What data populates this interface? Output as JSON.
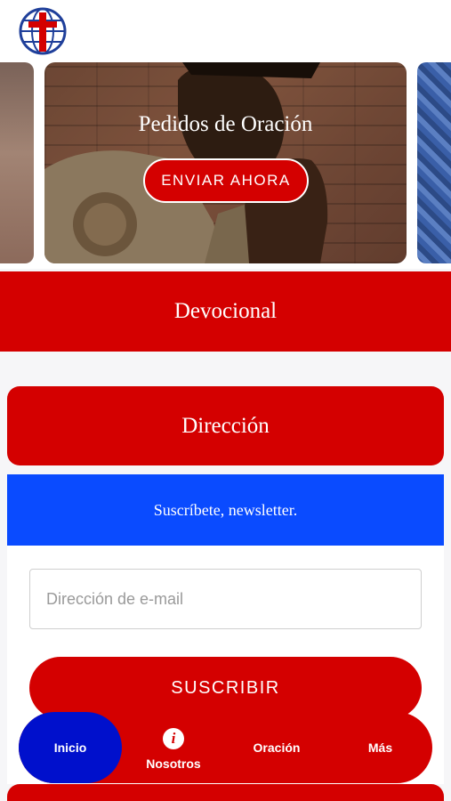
{
  "header": {
    "logo_icon": "globe-cross-logo"
  },
  "carousel": {
    "card": {
      "title": "Pedidos de Oración",
      "button_label": "ENVIAR AHORA"
    }
  },
  "sections": {
    "devocional_label": "Devocional",
    "direccion_label": "Dirección"
  },
  "newsletter": {
    "title": "Suscríbete, newsletter.",
    "email_placeholder": "Dirección de e-mail",
    "email_value": "",
    "subscribe_label": "SUSCRIBIR"
  },
  "tabbar": {
    "items": [
      {
        "label": "Inicio",
        "active": true
      },
      {
        "label": "Nosotros",
        "icon": "info-icon"
      },
      {
        "label": "Oración"
      },
      {
        "label": "Más"
      }
    ]
  },
  "colors": {
    "brand_red": "#d40000",
    "brand_blue": "#0a4bff",
    "active_tab": "#0010cc"
  }
}
